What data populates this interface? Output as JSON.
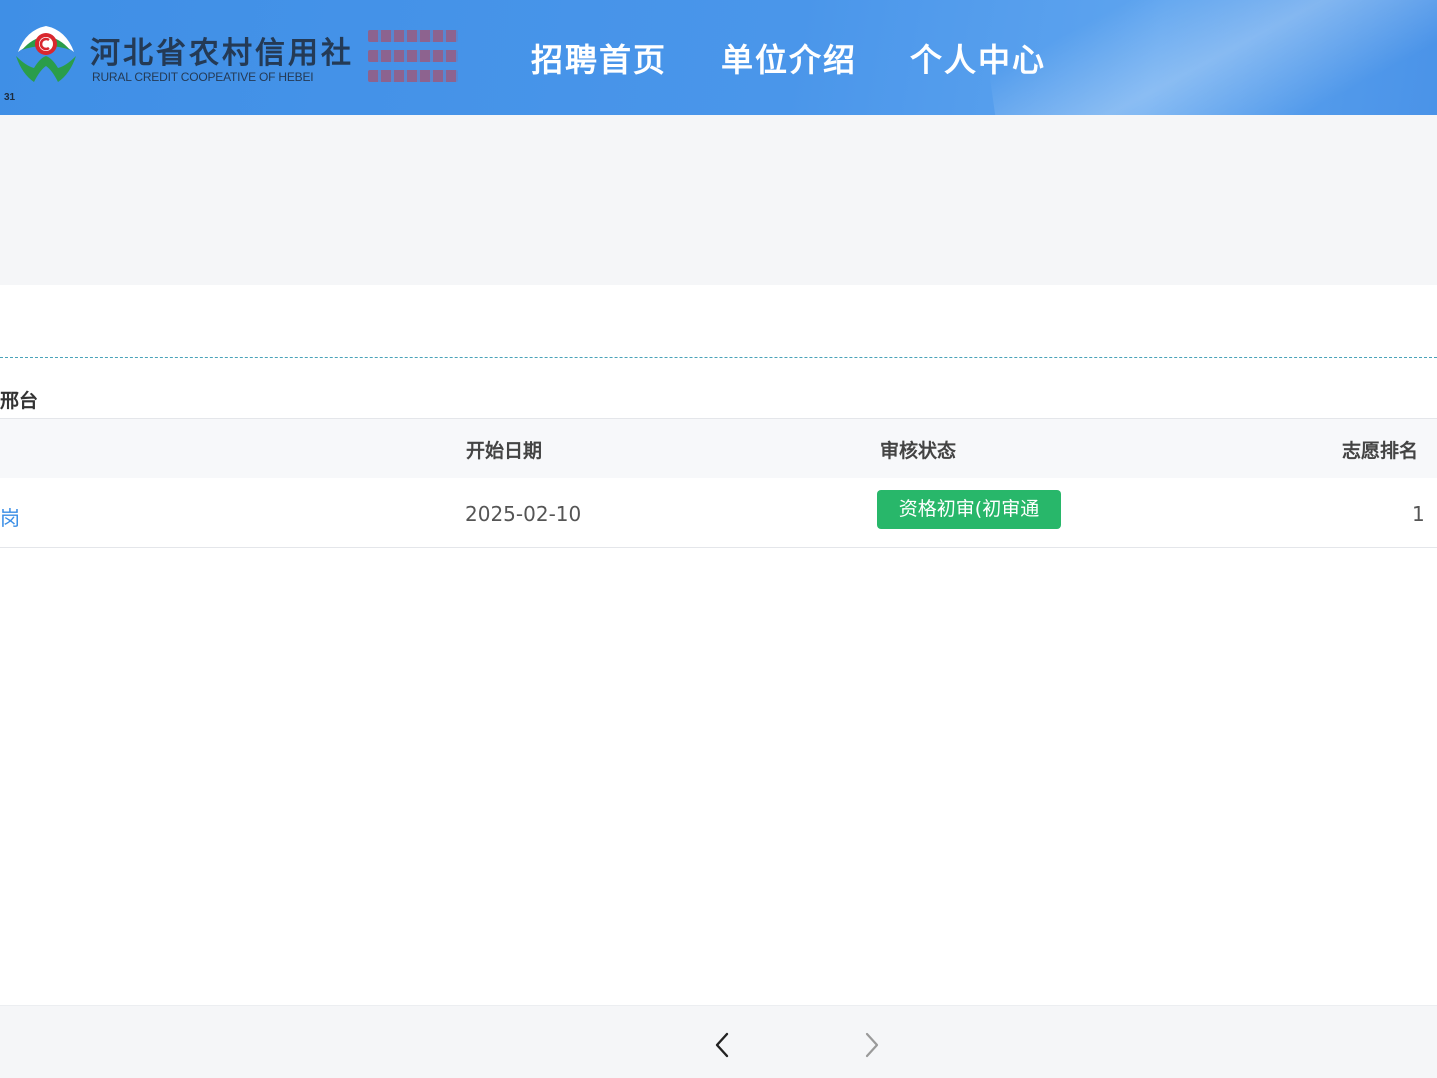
{
  "header": {
    "brand_cn": "河北省农村信用社",
    "brand_en": "RURAL CREDIT COOPEATIVE OF HEBEI",
    "brand_number": "31",
    "nav": [
      {
        "label": "招聘首页"
      },
      {
        "label": "单位介绍"
      },
      {
        "label": "个人中心"
      }
    ],
    "colors": {
      "bar": "#4591e8",
      "nav_text": "#ffffff",
      "logo_green": "#2a9d4a",
      "logo_red": "#d9272e"
    }
  },
  "section": {
    "title": "邢台"
  },
  "table": {
    "columns": [
      "开始日期",
      "审核状态",
      "志愿排名"
    ],
    "rows": [
      {
        "position": "岗",
        "start_date": "2025-02-10",
        "status": "资格初审(初审通",
        "rank": "1"
      }
    ],
    "status_color": "#28b76a"
  },
  "pager": {
    "prev_icon": "chevron-left-icon",
    "next_icon": "chevron-right-icon"
  }
}
